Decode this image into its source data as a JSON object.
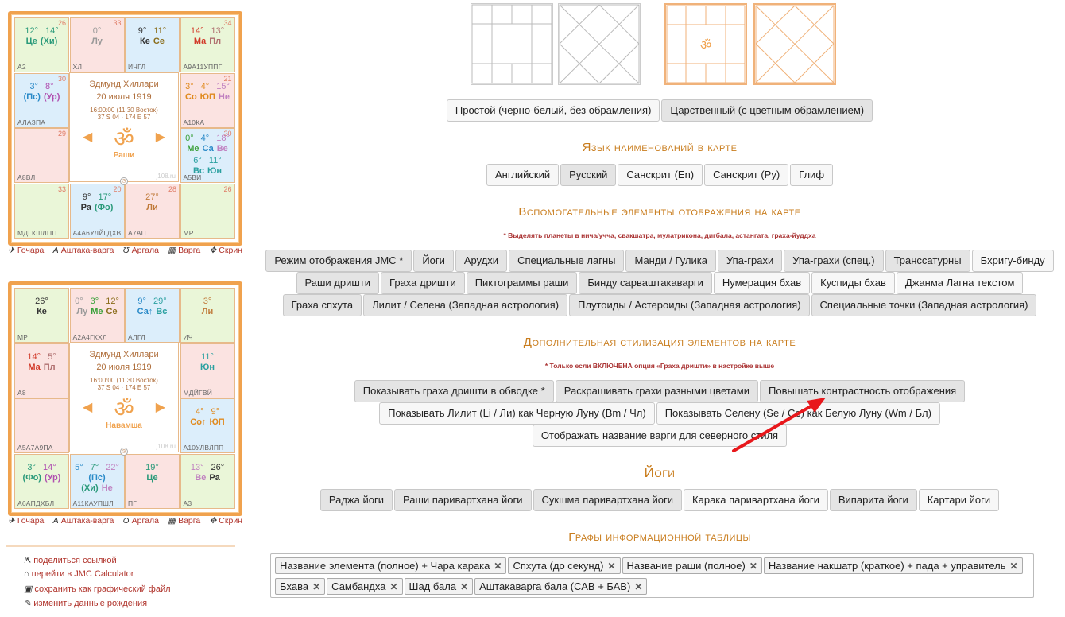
{
  "charts": [
    {
      "name": "Эдмунд Хиллари",
      "date": "20 июля 1919",
      "time": "16:00:00 (11:30 Восток)",
      "coords": "37 S 04 · 174 E 57",
      "varga": "Раши",
      "watermark": "j108.ru",
      "cells": [
        {
          "n": "26",
          "deg": [
            "12°",
            "14°"
          ],
          "pl": [
            "Це",
            "(Хи)"
          ],
          "bot": "А2",
          "c": "g"
        },
        {
          "n": "33",
          "deg": [
            "0°",
            ""
          ],
          "pl": [
            "Лу",
            ""
          ],
          "bot": "ХЛ",
          "c": "p"
        },
        {
          "n": "",
          "deg": [
            "9°",
            "11°"
          ],
          "pl": [
            "Ке",
            "Се"
          ],
          "bot": "ИЧГЛ",
          "c": "b"
        },
        {
          "n": "34",
          "deg": [
            "14°",
            "13°"
          ],
          "pl": [
            "Ма",
            "Пл"
          ],
          "bot": "А9А11УППГ",
          "c": "g"
        },
        {
          "n": "30",
          "deg": [
            "3°",
            "8°"
          ],
          "pl": [
            "(Пс)",
            "(Ур)"
          ],
          "bot": "АЛАЗПА",
          "c": "b"
        },
        {
          "n": "21",
          "deg": [
            "3°",
            "4°",
            "15°"
          ],
          "pl": [
            "Со",
            "ЮП",
            "Не"
          ],
          "bot": "А10КА",
          "c": "p"
        },
        {
          "n": "29",
          "deg": [
            "",
            ""
          ],
          "pl": [
            "",
            ""
          ],
          "bot": "А8ВЛ",
          "c": "p"
        },
        {
          "n": "20",
          "deg": [
            "0°",
            "4°",
            "18°"
          ],
          "pl": [
            "Ме",
            "Са",
            "Ве"
          ],
          "deg2": [
            "6°",
            "11°"
          ],
          "pl2": [
            "Вс",
            "Юн"
          ],
          "bot": "А5ВИ",
          "c": "b"
        },
        {
          "n": "33",
          "deg": [
            "",
            ""
          ],
          "pl": [
            "",
            ""
          ],
          "bot": "МДГКШЛПП",
          "c": "g"
        },
        {
          "n": "20",
          "deg": [
            "9°",
            "17°"
          ],
          "pl": [
            "Ра",
            "(Фо)"
          ],
          "bot": "А4А6УЛЙГДХВ",
          "c": "b"
        },
        {
          "n": "28",
          "deg": [
            "27°",
            ""
          ],
          "pl": [
            "Ли",
            ""
          ],
          "bot": "А7АП",
          "c": "p"
        },
        {
          "n": "26",
          "deg": [
            "",
            ""
          ],
          "pl": [
            "",
            ""
          ],
          "bot": "МР",
          "c": "g"
        }
      ]
    },
    {
      "name": "Эдмунд Хиллари",
      "date": "20 июля 1919",
      "time": "16:00:00 (11:30 Восток)",
      "coords": "37 S 04 · 174 E 57",
      "varga": "Навамша",
      "watermark": "j108.ru",
      "cells": [
        {
          "n": "",
          "deg": [
            "26°",
            ""
          ],
          "pl": [
            "Ке",
            ""
          ],
          "bot": "МР",
          "c": "g"
        },
        {
          "n": "",
          "deg": [
            "0°",
            "3°",
            "12°"
          ],
          "pl": [
            "Лу",
            "Ме",
            "Се"
          ],
          "bot": "А2А4ГКХЛ",
          "c": "p"
        },
        {
          "n": "",
          "deg": [
            "9°",
            "29°"
          ],
          "pl": [
            "Са↑",
            "Вс"
          ],
          "bot": "АЛГЛ",
          "c": "b"
        },
        {
          "n": "",
          "deg": [
            "3°",
            ""
          ],
          "pl": [
            "Ли",
            ""
          ],
          "bot": "ИЧ",
          "c": "g"
        },
        {
          "n": "",
          "deg": [
            "14°",
            "5°"
          ],
          "pl": [
            "Ма",
            "Пл"
          ],
          "bot": "А8",
          "c": "p"
        },
        {
          "n": "",
          "deg": [
            "11°",
            ""
          ],
          "pl": [
            "Юн",
            ""
          ],
          "bot": "МДЙГВЙ",
          "c": "p"
        },
        {
          "n": "",
          "deg": [
            "",
            ""
          ],
          "pl": [
            "",
            ""
          ],
          "bot": "А5А7А9ПА",
          "c": "p"
        },
        {
          "n": "",
          "deg": [
            "4°",
            "9°"
          ],
          "pl": [
            "Со↑",
            "ЮП"
          ],
          "bot": "А10УЛВЛПП",
          "c": "b"
        },
        {
          "n": "",
          "deg": [
            "3°",
            "14°"
          ],
          "pl": [
            "(Фо)",
            "(Ур)"
          ],
          "bot": "А6АПДХБЛ",
          "c": "g"
        },
        {
          "n": "",
          "deg": [
            "5°",
            "7°",
            "22°"
          ],
          "pl": [
            "(Пс)",
            "(Хи)",
            "Не"
          ],
          "bot": "А11КАУПШЛ",
          "c": "b"
        },
        {
          "n": "",
          "deg": [
            "19°",
            ""
          ],
          "pl": [
            "Це",
            ""
          ],
          "bot": "ПГ",
          "c": "p"
        },
        {
          "n": "",
          "deg": [
            "13°",
            "26°"
          ],
          "pl": [
            "Ве",
            "Ра"
          ],
          "bot": "А3",
          "c": "g"
        }
      ]
    }
  ],
  "chart_links": [
    "Гочара",
    "Аштака-варга",
    "Аргала",
    "Варга",
    "Скрин"
  ],
  "side_links": [
    "поделиться ссылкой",
    "перейти в JMC Calculator",
    "сохранить как графический файл",
    "изменить данные рождения"
  ],
  "style_buttons": [
    "Простой (черно-белый, без обрамления)",
    "Царственный (с цветным обрамлением)"
  ],
  "sections": {
    "lang": "Язык наименований в карте",
    "aux": "Вспомогательные элементы отображения на карте",
    "aux_note": "* Выделять планеты в нича/учча, свакшатра, мулатрикона, дигбала, астангата, граха-йуддха",
    "style": "Дополнительная стилизация элементов на карте",
    "style_note": "* Только если ВКЛЮЧЕНА опция «Граха дришти» в настройке выше",
    "yogas": "Йоги",
    "cols": "Графы информационной таблицы"
  },
  "lang_buttons": [
    "Английский",
    "Русский",
    "Санскрит (En)",
    "Санскрит (Ру)",
    "Глиф"
  ],
  "aux_row1": [
    "Режим отображения JMC *",
    "Йоги",
    "Арудхи",
    "Специальные лагны",
    "Манди / Гулика",
    "Упа-грахи",
    "Упа-грахи (спец.)",
    "Транссатурны",
    "Бхригу-бинду"
  ],
  "aux_row2": [
    "Раши дришти",
    "Граха дришти",
    "Пиктограммы раши",
    "Бинду сарваштакаварги",
    "Нумерация бхав",
    "Куспиды бхав",
    "Джанма Лагна текстом"
  ],
  "aux_row3": [
    "Граха спхута",
    "Лилит / Селена (Западная астрология)",
    "Плутоиды / Астероиды (Западная астрология)",
    "Специальные точки (Западная астрология)"
  ],
  "style_row1": [
    "Показывать граха дришти в обводке *",
    "Раскрашивать грахи разными цветами",
    "Повышать контрастность отображения"
  ],
  "style_row2": [
    "Показывать Лилит (Li / Ли) как Черную Луну (Bm / Чл)",
    "Показывать Селену (Se / Се) как Белую Луну (Wm / Бл)"
  ],
  "style_row3": [
    "Отображать название варги для северного стиля"
  ],
  "yoga_buttons": [
    "Раджа йоги",
    "Раши паривартхана йоги",
    "Сукшма паривартхана йоги",
    "Карака паривартхана йоги",
    "Випарита йоги",
    "Картари йоги"
  ],
  "tags": [
    "Название элемента (полное) + Чара карака",
    "Спхута (до секунд)",
    "Название раши (полное)",
    "Название накшатр (краткое) + пада + управитель",
    "Бхава",
    "Самбандха",
    "Шад бала",
    "Аштакаварга бала (САВ + БАВ)"
  ],
  "colors": {
    "accent": "#f0a24e",
    "heading": "#c97d1e",
    "link": "#b0342c",
    "arrow": "#e8171b"
  }
}
